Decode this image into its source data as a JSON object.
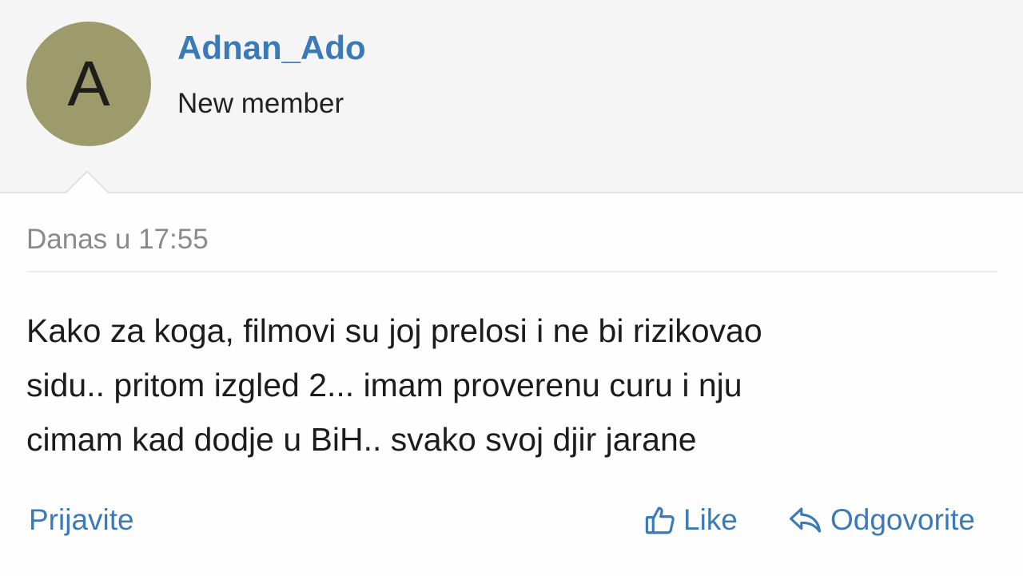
{
  "user": {
    "avatar_letter": "A",
    "avatar_color": "#9d9b6b",
    "name": "Adnan_Ado",
    "title": "New member"
  },
  "post": {
    "timestamp": "Danas u 17:55",
    "lines": [
      "Kako za koga, filmovi su joj prelosi i ne bi rizikovao",
      "sidu.. pritom izgled 2... imam proverenu curu i nju",
      "cimam kad dodje u BiH.. svako svoj djir jarane"
    ]
  },
  "actions": {
    "report_label": "Prijavite",
    "like_label": "Like",
    "like_icon": "thumbs-up-icon",
    "reply_label": "Odgovorite",
    "reply_icon": "reply-arrow-icon"
  },
  "colors": {
    "link": "#3a7ab8",
    "header_bg": "#f5f5f5"
  }
}
